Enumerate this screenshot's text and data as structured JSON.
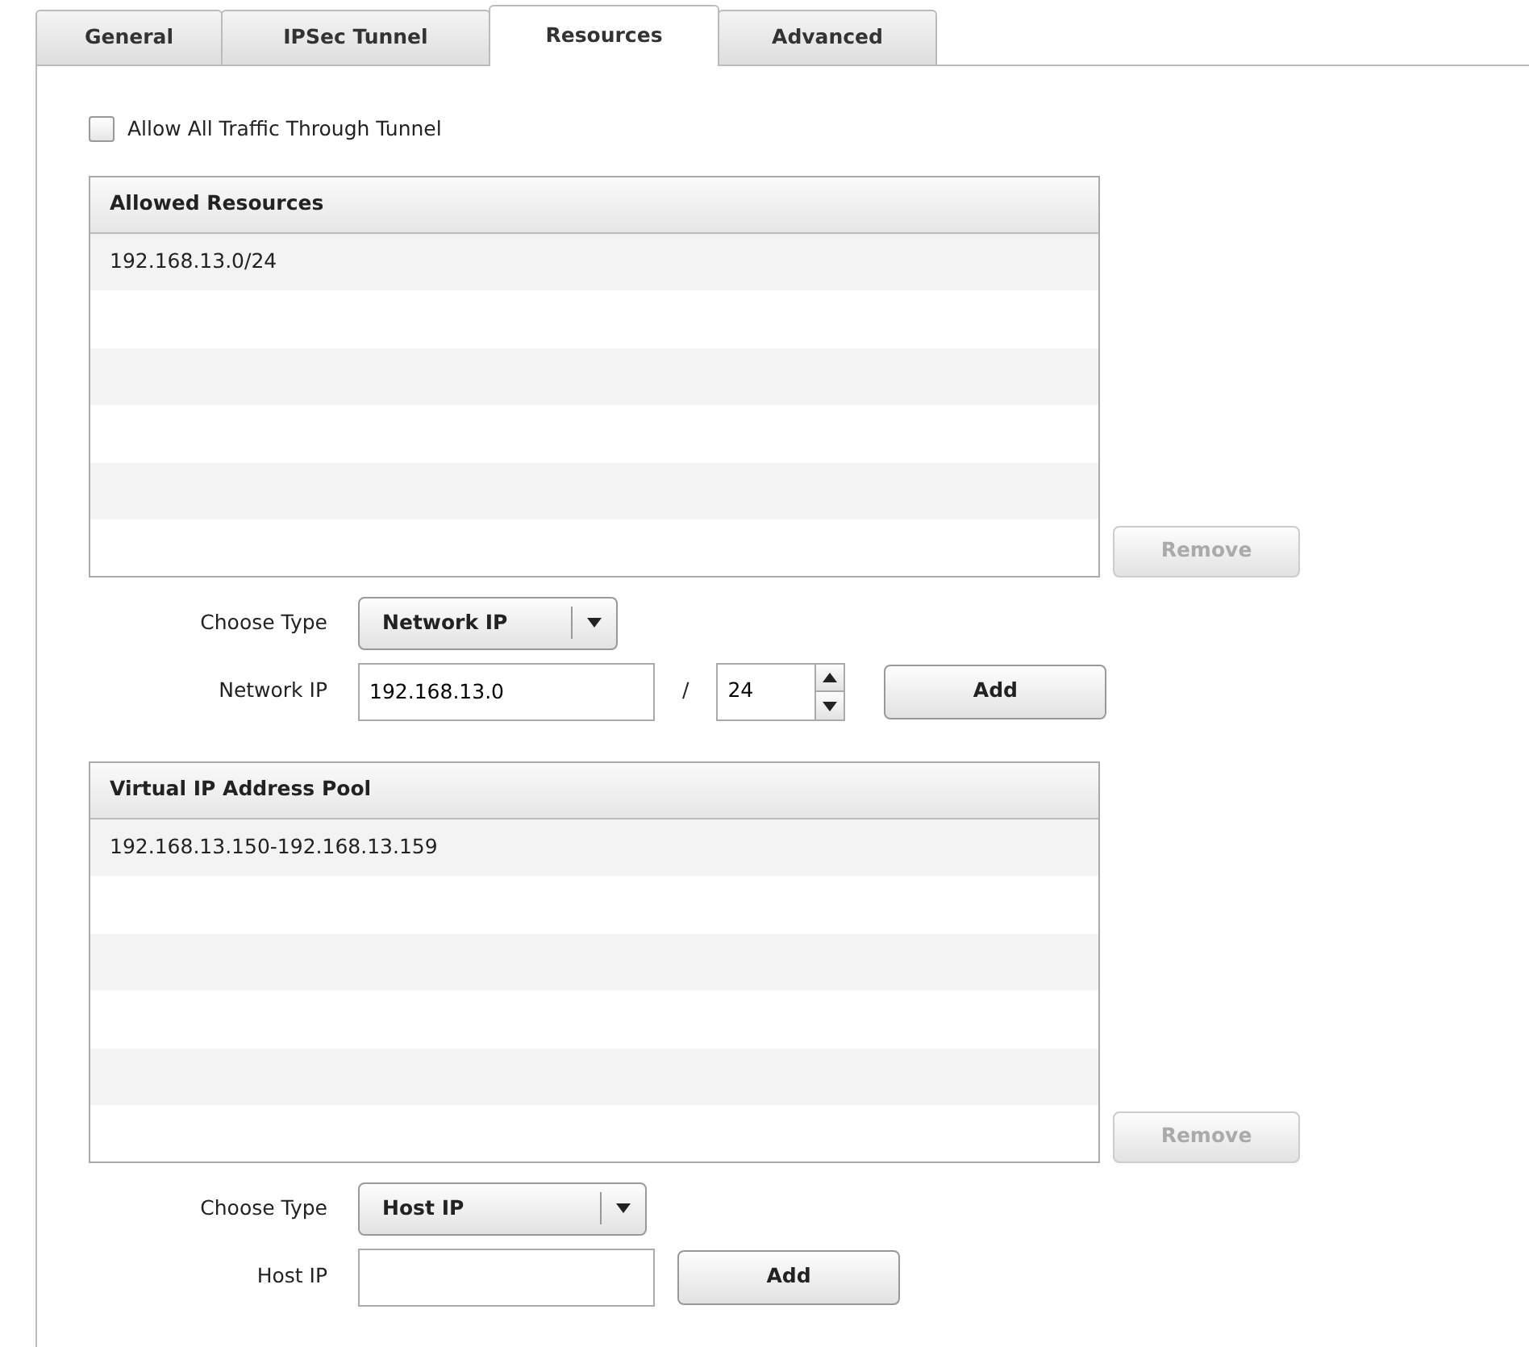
{
  "tabs": [
    {
      "label": "General",
      "selected": false
    },
    {
      "label": "IPSec Tunnel",
      "selected": false
    },
    {
      "label": "Resources",
      "selected": true
    },
    {
      "label": "Advanced",
      "selected": false
    }
  ],
  "allow_all_traffic": {
    "label": "Allow All Traffic Through Tunnel",
    "checked": false
  },
  "sections": [
    {
      "header": "Allowed Resources",
      "rows": [
        "192.168.13.0/24"
      ],
      "remove_button": {
        "label": "Remove",
        "disabled": true
      },
      "choose_type_label": "Choose Type",
      "type_select": "Network IP",
      "entry": {
        "kind": "network",
        "label": "Network IP",
        "value": "192.168.13.0",
        "separator": "/",
        "prefix": "24",
        "add_button": "Add"
      }
    },
    {
      "header": "Virtual IP Address Pool",
      "rows": [
        "192.168.13.150-192.168.13.159"
      ],
      "remove_button": {
        "label": "Remove",
        "disabled": true
      },
      "choose_type_label": "Choose Type",
      "type_select": "Host IP",
      "entry": {
        "kind": "host",
        "label": "Host IP",
        "add_button": "Add"
      }
    }
  ]
}
